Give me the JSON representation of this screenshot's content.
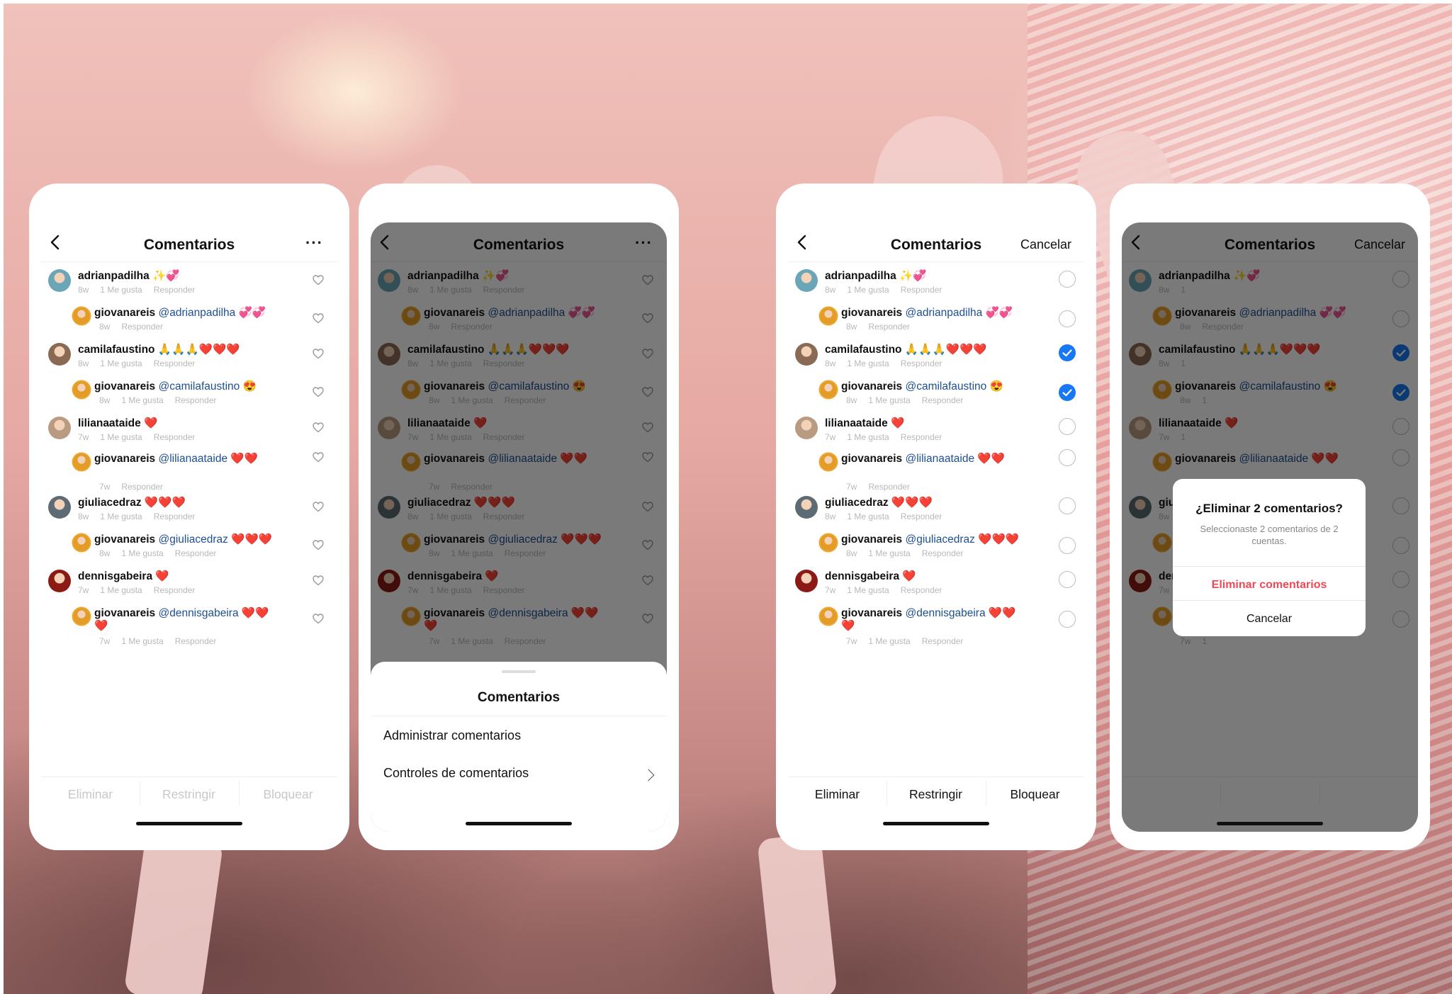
{
  "header": {
    "title": "Comentarios",
    "more": "···",
    "cancel": "Cancelar"
  },
  "time": {
    "w8": "8w",
    "w7": "7w"
  },
  "actions": {
    "likes": "1 Me gusta",
    "reply": "Responder",
    "one": "1"
  },
  "comments": [
    {
      "user": "adrianpadilha",
      "text": "✨💞",
      "mention": "",
      "time": "8w",
      "level": "top",
      "avatar_color": "#6aa6b8"
    },
    {
      "user": "giovanareis",
      "mention": "@adrianpadilha",
      "text": "💞💞",
      "time": "8w",
      "level": "reply",
      "avatar_color": "#e29c27"
    },
    {
      "user": "camilafaustino",
      "text": "🙏🙏🙏❤️❤️❤️",
      "mention": "",
      "time": "8w",
      "level": "top",
      "avatar_color": "#8a6a55"
    },
    {
      "user": "giovanareis",
      "mention": "@camilafaustino",
      "text": "😍",
      "time": "8w",
      "level": "reply",
      "avatar_color": "#e29c27"
    },
    {
      "user": "lilianaataide",
      "text": "❤️",
      "mention": "",
      "time": "7w",
      "level": "top",
      "avatar_color": "#b89b80"
    },
    {
      "user": "giovanareis",
      "mention": "@lilianaataide",
      "text": "❤️❤️",
      "time": "7w",
      "level": "reply",
      "avatar_color": "#e29c27"
    },
    {
      "user": "giuliacedraz",
      "text": "❤️❤️❤️",
      "mention": "",
      "time": "8w",
      "level": "top",
      "avatar_color": "#5c6b74"
    },
    {
      "user": "giovanareis",
      "mention": "@giuliacedraz",
      "text": "❤️❤️❤️",
      "time": "8w",
      "level": "reply",
      "avatar_color": "#e29c27"
    },
    {
      "user": "dennisgabeira",
      "text": "❤️",
      "mention": "",
      "time": "7w",
      "level": "top",
      "avatar_color": "#8b1a14"
    },
    {
      "user": "giovanareis",
      "mention": "@dennisgabeira",
      "text": "❤️❤️",
      "wrapped": "❤️",
      "time": "7w",
      "level": "reply",
      "avatar_color": "#e29c27"
    }
  ],
  "footer": {
    "delete": "Eliminar",
    "restrict": "Restringir",
    "block": "Bloquear"
  },
  "sheet": {
    "title": "Comentarios",
    "manage": "Administrar comentarios",
    "controls": "Controles de comentarios"
  },
  "dialog": {
    "title": "¿Eliminar 2 comentarios?",
    "body": "Seleccionaste 2 comentarios de 2 cuentas.",
    "confirm": "Eliminar comentarios",
    "cancel": "Cancelar"
  },
  "selected": [
    false,
    false,
    true,
    true,
    false,
    false,
    false,
    false,
    false,
    false
  ],
  "colors": {
    "accent": "#1877f2",
    "danger": "#ed4956",
    "mention": "#1d4f91"
  }
}
